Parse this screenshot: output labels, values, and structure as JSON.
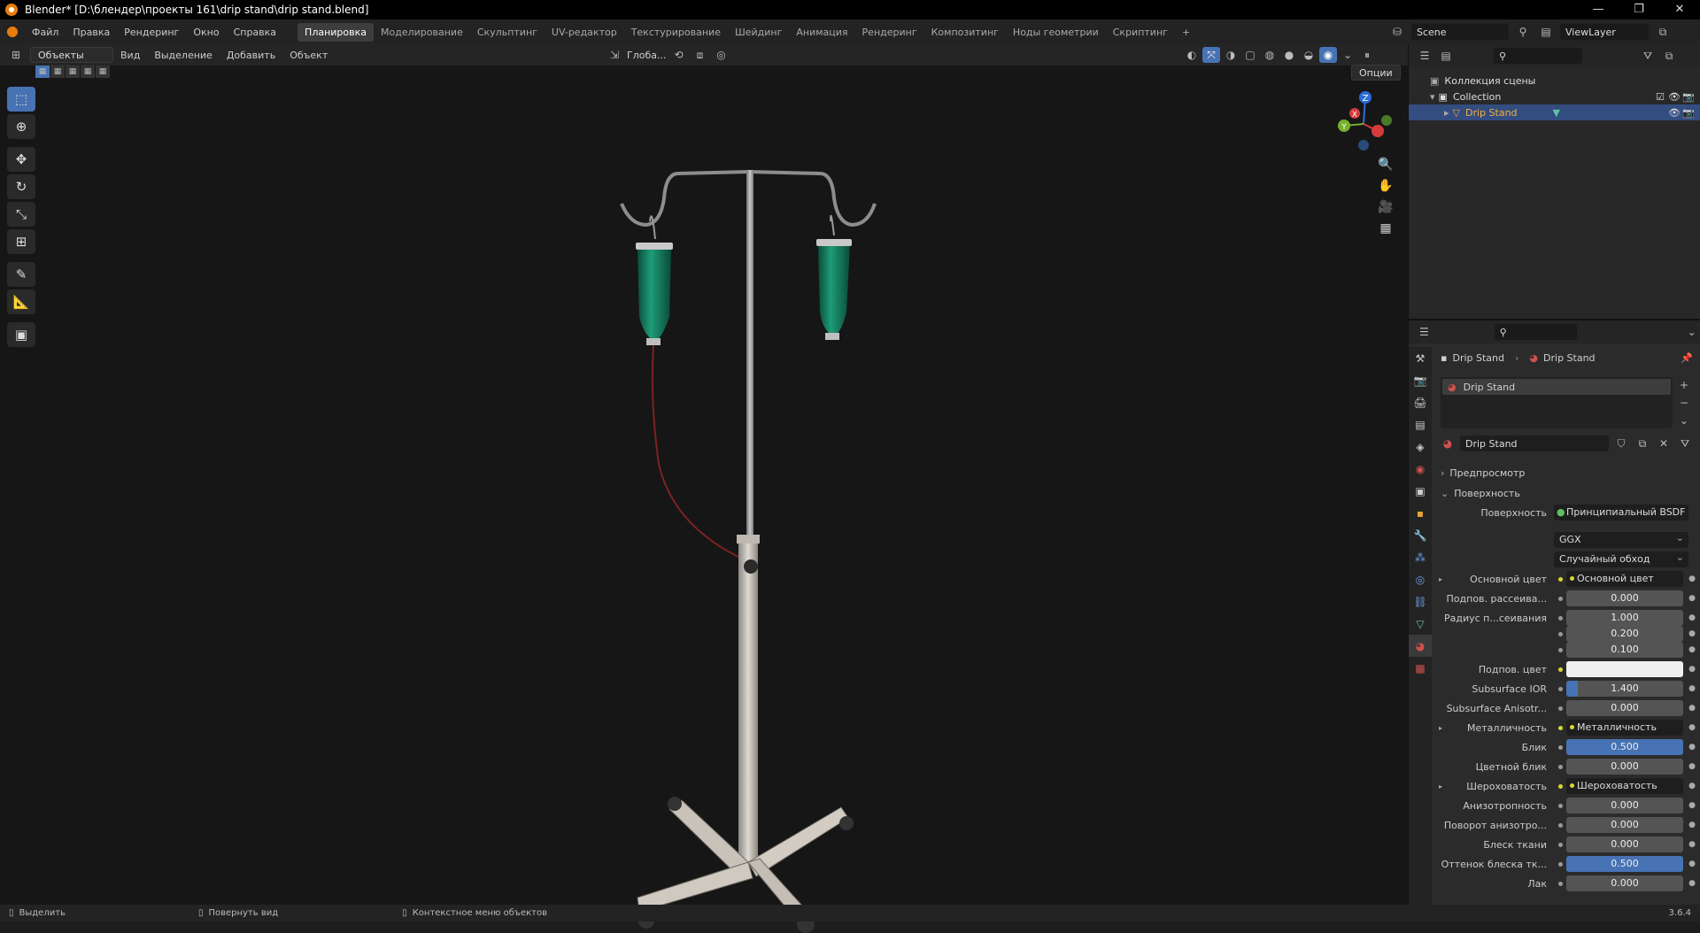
{
  "window": {
    "title": "Blender* [D:\\блендер\\проекты 161\\drip stand\\drip stand.blend]",
    "controls": [
      "—",
      "❐",
      "✕"
    ]
  },
  "menu": [
    "Файл",
    "Правка",
    "Рендеринг",
    "Окно",
    "Справка"
  ],
  "workspaces": [
    "Планировка",
    "Моделирование",
    "Скульптинг",
    "UV-редактор",
    "Текстурирование",
    "Шейдинг",
    "Анимация",
    "Рендеринг",
    "Композитинг",
    "Ноды геометрии",
    "Скриптинг",
    "+"
  ],
  "active_workspace": "Планировка",
  "scene": {
    "name": "Scene",
    "view_layer": "ViewLayer"
  },
  "viewport_header": {
    "mode": "Объекты",
    "menus": [
      "Вид",
      "Выделение",
      "Добавить",
      "Объект"
    ],
    "orientation": "Глоба...",
    "options": "Опции"
  },
  "toolbar": [
    {
      "name": "select-box",
      "icon": "⬚"
    },
    {
      "name": "cursor",
      "icon": "⊕"
    },
    {
      "name": "move",
      "icon": "✥"
    },
    {
      "name": "rotate",
      "icon": "↻"
    },
    {
      "name": "scale",
      "icon": "⤡"
    },
    {
      "name": "transform",
      "icon": "⊞"
    },
    {
      "name": "annotate",
      "icon": "✎"
    },
    {
      "name": "measure",
      "icon": "📐"
    },
    {
      "name": "add-cube",
      "icon": "▣"
    }
  ],
  "gizmo": {
    "z": "Z",
    "x": "X",
    "y": "Y"
  },
  "outliner": {
    "root": "Коллекция сцены",
    "collection": "Collection",
    "object": "Drip Stand"
  },
  "properties": {
    "breadcrumb": [
      "Drip Stand",
      "Drip Stand"
    ],
    "material_slot": "Drip Stand",
    "material_name": "Drip Stand",
    "sections": {
      "preview": "Предпросмотр",
      "surface": "Поверхность"
    },
    "surface_label": "Поверхность",
    "surface_value": "Принципиальный BSDF",
    "distribution": "GGX",
    "subsurface_method": "Случайный обход",
    "rows": [
      {
        "label": "Основной цвет",
        "type": "link",
        "value": "Основной цвет"
      },
      {
        "label": "Подпов. рассеива...",
        "type": "num",
        "value": "0.000",
        "fill": 0
      },
      {
        "label": "Радиус п...сеивания",
        "type": "num",
        "value": "1.000",
        "fill": 0
      },
      {
        "label": "",
        "type": "num",
        "value": "0.200",
        "fill": 0
      },
      {
        "label": "",
        "type": "num",
        "value": "0.100",
        "fill": 0
      },
      {
        "label": "Подпов. цвет",
        "type": "color",
        "value": "#f0f0f0"
      },
      {
        "label": "Subsurface IOR",
        "type": "num",
        "value": "1.400",
        "fill": 0.1
      },
      {
        "label": "Subsurface Anisotr...",
        "type": "num",
        "value": "0.000",
        "fill": 0
      },
      {
        "label": "Металличность",
        "type": "link",
        "value": "Металличность"
      },
      {
        "label": "Блик",
        "type": "num",
        "value": "0.500",
        "fill": 1
      },
      {
        "label": "Цветной блик",
        "type": "num",
        "value": "0.000",
        "fill": 0
      },
      {
        "label": "Шероховатость",
        "type": "link",
        "value": "Шероховатость"
      },
      {
        "label": "Анизотропность",
        "type": "num",
        "value": "0.000",
        "fill": 0
      },
      {
        "label": "Поворот анизотро...",
        "type": "num",
        "value": "0.000",
        "fill": 0
      },
      {
        "label": "Блеск ткани",
        "type": "num",
        "value": "0.000",
        "fill": 0
      },
      {
        "label": "Оттенок блеска тк...",
        "type": "num",
        "value": "0.500",
        "fill": 1
      },
      {
        "label": "Лак",
        "type": "num",
        "value": "0.000",
        "fill": 0
      }
    ]
  },
  "statusbar": {
    "select": "Выделить",
    "rotate": "Повернуть вид",
    "context": "Контекстное меню объектов",
    "version": "3.6.4"
  }
}
